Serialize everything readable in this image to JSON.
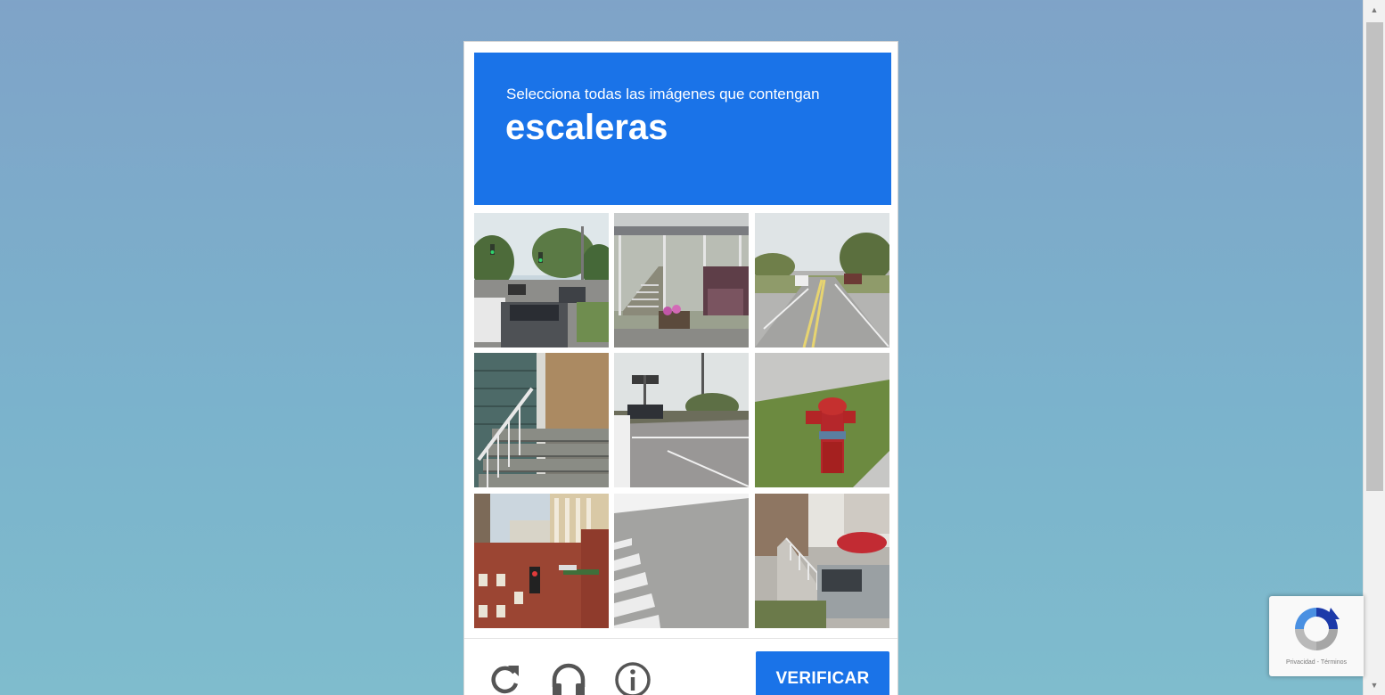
{
  "challenge": {
    "prompt": "Selecciona todas las imágenes que contengan",
    "keyword": "escaleras",
    "tiles": [
      "street-traffic-lights",
      "porch-stairs",
      "road",
      "stair-railing",
      "intersection",
      "fire-hydrant",
      "brick-building",
      "crosswalk",
      "stairs-houses"
    ]
  },
  "controls": {
    "verify_label": "VERIFICAR",
    "reload_icon": "reload-icon",
    "audio_icon": "headphones-icon",
    "info_icon": "info-icon"
  },
  "badge": {
    "privacy": "Privacidad",
    "separator": "-",
    "terms": "Términos"
  },
  "colors": {
    "accent": "#1a73e8",
    "background": "#7fb3cc"
  }
}
